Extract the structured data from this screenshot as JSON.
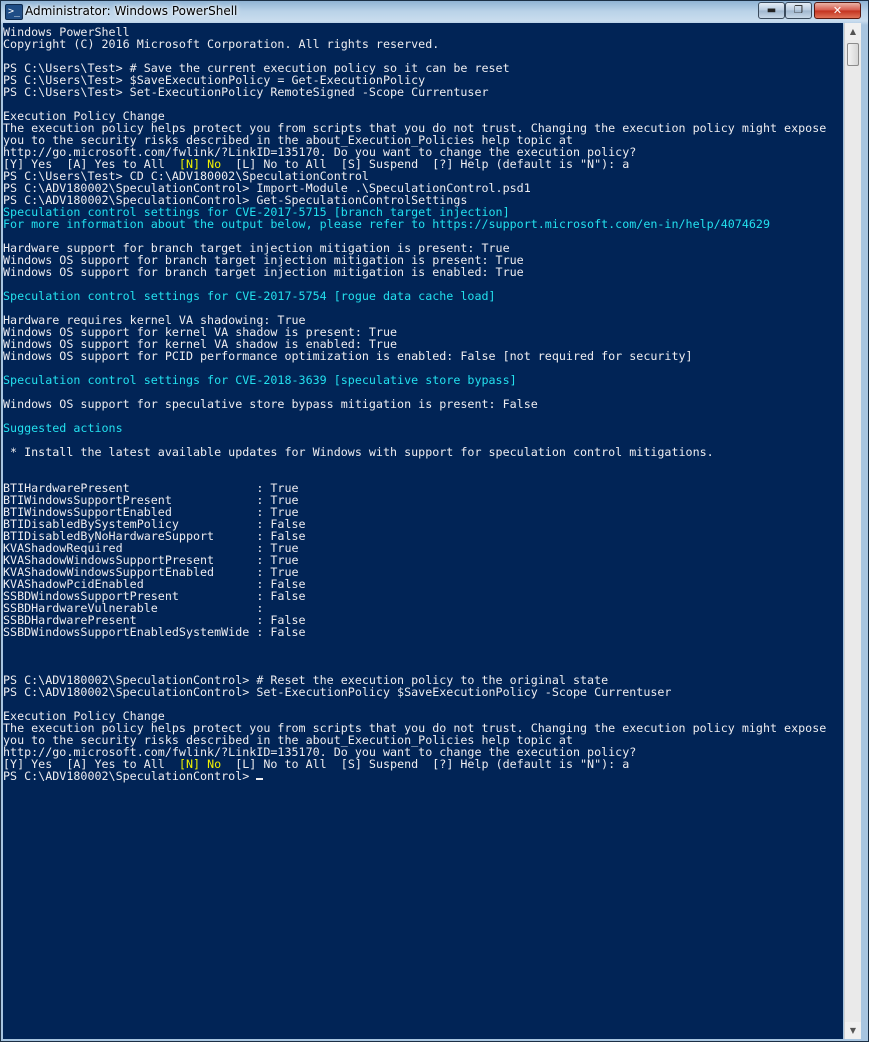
{
  "window": {
    "title": "Administrator: Windows PowerShell",
    "app_icon": "powershell-icon",
    "controls": {
      "minimize": "minimize-icon",
      "maximize": "maximize-icon",
      "close": "close-icon"
    }
  },
  "colors": {
    "console_background": "#012456",
    "default_text": "#eeedf0",
    "highlight_cyan": "#23e0ee",
    "highlight_yellow": "#f2f200"
  },
  "console": {
    "lines": [
      [
        {
          "t": "Windows PowerShell"
        }
      ],
      [
        {
          "t": "Copyright (C) 2016 Microsoft Corporation. All rights reserved."
        }
      ],
      [
        {
          "t": ""
        }
      ],
      [
        {
          "t": "PS C:\\Users\\Test> # Save the current execution policy so it can be reset"
        }
      ],
      [
        {
          "t": "PS C:\\Users\\Test> $SaveExecutionPolicy = Get-ExecutionPolicy"
        }
      ],
      [
        {
          "t": "PS C:\\Users\\Test> Set-ExecutionPolicy RemoteSigned -Scope Currentuser"
        }
      ],
      [
        {
          "t": ""
        }
      ],
      [
        {
          "t": "Execution Policy Change"
        }
      ],
      [
        {
          "t": "The execution policy helps protect you from scripts that you do not trust. Changing the execution policy might expose"
        }
      ],
      [
        {
          "t": "you to the security risks described in the about_Execution_Policies help topic at"
        }
      ],
      [
        {
          "t": "http://go.microsoft.com/fwlink/?LinkID=135170. Do you want to change the execution policy?"
        }
      ],
      [
        {
          "t": "[Y] Yes  [A] Yes to All  "
        },
        {
          "t": "[N] No",
          "c": "yellow"
        },
        {
          "t": "  [L] No to All  [S] Suspend  [?] Help (default is \"N\"): a"
        }
      ],
      [
        {
          "t": "PS C:\\Users\\Test> CD C:\\ADV180002\\SpeculationControl"
        }
      ],
      [
        {
          "t": "PS C:\\ADV180002\\SpeculationControl> Import-Module .\\SpeculationControl.psd1"
        }
      ],
      [
        {
          "t": "PS C:\\ADV180002\\SpeculationControl> Get-SpeculationControlSettings"
        }
      ],
      [
        {
          "t": "Speculation control settings for CVE-2017-5715 [branch target injection]",
          "c": "cyan"
        }
      ],
      [
        {
          "t": "For more information about the output below, please refer to https://support.microsoft.com/en-in/help/4074629",
          "c": "cyan"
        }
      ],
      [
        {
          "t": ""
        }
      ],
      [
        {
          "t": "Hardware support for branch target injection mitigation is present: True"
        }
      ],
      [
        {
          "t": "Windows OS support for branch target injection mitigation is present: True"
        }
      ],
      [
        {
          "t": "Windows OS support for branch target injection mitigation is enabled: True"
        }
      ],
      [
        {
          "t": ""
        }
      ],
      [
        {
          "t": "Speculation control settings for CVE-2017-5754 [rogue data cache load]",
          "c": "cyan"
        }
      ],
      [
        {
          "t": ""
        }
      ],
      [
        {
          "t": "Hardware requires kernel VA shadowing: True"
        }
      ],
      [
        {
          "t": "Windows OS support for kernel VA shadow is present: True"
        }
      ],
      [
        {
          "t": "Windows OS support for kernel VA shadow is enabled: True"
        }
      ],
      [
        {
          "t": "Windows OS support for PCID performance optimization is enabled: False [not required for security]"
        }
      ],
      [
        {
          "t": ""
        }
      ],
      [
        {
          "t": "Speculation control settings for CVE-2018-3639 [speculative store bypass]",
          "c": "cyan"
        }
      ],
      [
        {
          "t": ""
        }
      ],
      [
        {
          "t": "Windows OS support for speculative store bypass mitigation is present: False"
        }
      ],
      [
        {
          "t": ""
        }
      ],
      [
        {
          "t": "Suggested actions",
          "c": "cyan"
        }
      ],
      [
        {
          "t": ""
        }
      ],
      [
        {
          "t": " * Install the latest available updates for Windows with support for speculation control mitigations."
        }
      ],
      [
        {
          "t": ""
        }
      ],
      [
        {
          "t": ""
        }
      ],
      [
        {
          "t": "BTIHardwarePresent                  : True"
        }
      ],
      [
        {
          "t": "BTIWindowsSupportPresent            : True"
        }
      ],
      [
        {
          "t": "BTIWindowsSupportEnabled            : True"
        }
      ],
      [
        {
          "t": "BTIDisabledBySystemPolicy           : False"
        }
      ],
      [
        {
          "t": "BTIDisabledByNoHardwareSupport      : False"
        }
      ],
      [
        {
          "t": "KVAShadowRequired                   : True"
        }
      ],
      [
        {
          "t": "KVAShadowWindowsSupportPresent      : True"
        }
      ],
      [
        {
          "t": "KVAShadowWindowsSupportEnabled      : True"
        }
      ],
      [
        {
          "t": "KVAShadowPcidEnabled                : False"
        }
      ],
      [
        {
          "t": "SSBDWindowsSupportPresent           : False"
        }
      ],
      [
        {
          "t": "SSBDHardwareVulnerable              :"
        }
      ],
      [
        {
          "t": "SSBDHardwarePresent                 : False"
        }
      ],
      [
        {
          "t": "SSBDWindowsSupportEnabledSystemWide : False"
        }
      ],
      [
        {
          "t": ""
        }
      ],
      [
        {
          "t": ""
        }
      ],
      [
        {
          "t": ""
        }
      ],
      [
        {
          "t": "PS C:\\ADV180002\\SpeculationControl> # Reset the execution policy to the original state"
        }
      ],
      [
        {
          "t": "PS C:\\ADV180002\\SpeculationControl> Set-ExecutionPolicy $SaveExecutionPolicy -Scope Currentuser"
        }
      ],
      [
        {
          "t": ""
        }
      ],
      [
        {
          "t": "Execution Policy Change"
        }
      ],
      [
        {
          "t": "The execution policy helps protect you from scripts that you do not trust. Changing the execution policy might expose"
        }
      ],
      [
        {
          "t": "you to the security risks described in the about_Execution_Policies help topic at"
        }
      ],
      [
        {
          "t": "http://go.microsoft.com/fwlink/?LinkID=135170. Do you want to change the execution policy?"
        }
      ],
      [
        {
          "t": "[Y] Yes  [A] Yes to All  "
        },
        {
          "t": "[N] No",
          "c": "yellow"
        },
        {
          "t": "  [L] No to All  [S] Suspend  [?] Help (default is \"N\"): a"
        }
      ],
      [
        {
          "t": "PS C:\\ADV180002\\SpeculationControl> "
        }
      ]
    ]
  },
  "scrollbar": {
    "up_icon": "scroll-up-arrow-icon",
    "down_icon": "scroll-down-arrow-icon"
  }
}
